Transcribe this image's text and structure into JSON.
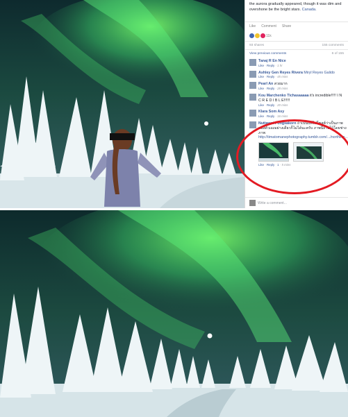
{
  "post": {
    "caption_text": "the aurora gradually appeared, though it was dim and overshone be the bright stars. ",
    "caption_place": "Canada.",
    "actions": {
      "like": "Like",
      "comment": "Comment",
      "share": "Share"
    },
    "reaction_count": "11k",
    "shares": "93 shares",
    "comments_count": "155 comments",
    "view_previous": "View previous comments",
    "page_position": "6 of 155",
    "write_placeholder": "Write a comment..."
  },
  "comments": [
    {
      "name": "Tanaj R En Nice",
      "text": "",
      "meta_like": "Like",
      "meta_reply": "Reply",
      "time": "1 hr"
    },
    {
      "name": "Ashley Gen Reyes Rivera",
      "text": "Miryl Reyes Galido",
      "meta_like": "Like",
      "meta_reply": "Reply",
      "time": "45 mins"
    },
    {
      "name": "Pearl An",
      "text": "สวยมาก",
      "meta_like": "Like",
      "meta_reply": "Reply",
      "time": "28 mins"
    },
    {
      "name": "Kou Marchenko Tichasaaaaa",
      "text": "it's incredible!!!!! I N C R E D I B L E!!!!!!",
      "meta_like": "Like",
      "meta_reply": "Reply",
      "time": "20 mins"
    },
    {
      "name": "Klara Som Asy",
      "text": "",
      "meta_like": "Like",
      "meta_reply": "Reply",
      "time": "16 mins"
    }
  ],
  "highlighted_comment": {
    "name": "Nuttawat Pongsakorn",
    "text": "ถ้าเป็นแค่ไปโพสต์ว่าเป็นภาพของตัวเองอย่างเดียวก็ไม่ได้นะครับ ภาพนี้ถ่ายไว้โดยช่างภาพ",
    "link": "http://timatomanephotography.tumblr.com/.../northern...",
    "meta_like": "Like",
    "meta_reply": "Reply",
    "replies": "1",
    "time": "5 mins"
  },
  "colors": {
    "fb_link": "#365899",
    "highlight": "#e31b23",
    "aurora": "#3ddc6a"
  }
}
